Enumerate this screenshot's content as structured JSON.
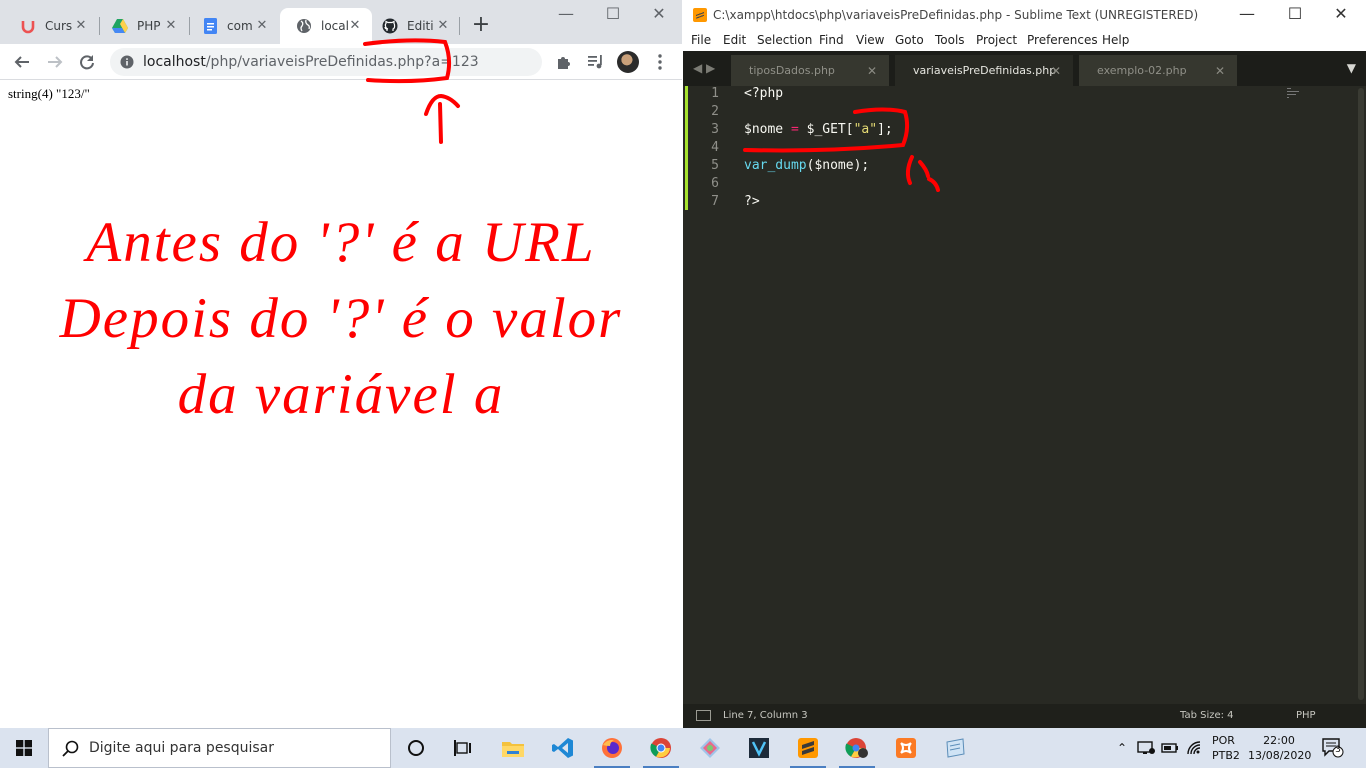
{
  "chrome": {
    "tabs": [
      {
        "title": "Curs",
        "icon": "udemy-icon"
      },
      {
        "title": "PHP",
        "icon": "google-drive-icon"
      },
      {
        "title": "com",
        "icon": "google-docs-icon"
      },
      {
        "title": "local",
        "icon": "globe-icon",
        "active": true
      },
      {
        "title": "Editi",
        "icon": "github-icon"
      }
    ],
    "new_tab": "+",
    "address": {
      "host": "localhost",
      "path": "/php/variaveisPreDefinidas.php?a=123"
    },
    "page": {
      "dump_output": "string(4) \"123/\"",
      "annotation_lines": [
        "Antes do '?' é a URL",
        "Depois do '?' é o valor",
        "da variável a"
      ]
    }
  },
  "sublime": {
    "title": "C:\\xampp\\htdocs\\php\\variaveisPreDefinidas.php - Sublime Text (UNREGISTERED)",
    "menu": [
      "File",
      "Edit",
      "Selection",
      "Find",
      "View",
      "Goto",
      "Tools",
      "Project",
      "Preferences",
      "Help"
    ],
    "tabs": [
      {
        "name": "tiposDados.php"
      },
      {
        "name": "variaveisPreDefinidas.php",
        "active": true
      },
      {
        "name": "exemplo-02.php"
      }
    ],
    "line_numbers": [
      "1",
      "2",
      "3",
      "4",
      "5",
      "6",
      "7"
    ],
    "code": {
      "line1": "<?php",
      "line3_var": "$nome",
      "line3_op": "=",
      "line3_get": "$_GET[",
      "line3_str": "\"a\"",
      "line3_end": "];",
      "line5_fn": "var_dump",
      "line5_args": "($nome);",
      "line7": "?>"
    },
    "status": {
      "position": "Line 7, Column 3",
      "tab_size": "Tab Size: 4",
      "syntax": "PHP"
    }
  },
  "taskbar": {
    "search_placeholder": "Digite aqui para pesquisar",
    "language": {
      "lang": "POR",
      "layout": "PTB2"
    },
    "clock": {
      "time": "22:00",
      "date": "13/08/2020"
    },
    "notification_count": "3"
  },
  "colors": {
    "annotation": "#ff0000",
    "sublime_bg": "#282923",
    "taskbar_bg": "#dbe3ef"
  }
}
